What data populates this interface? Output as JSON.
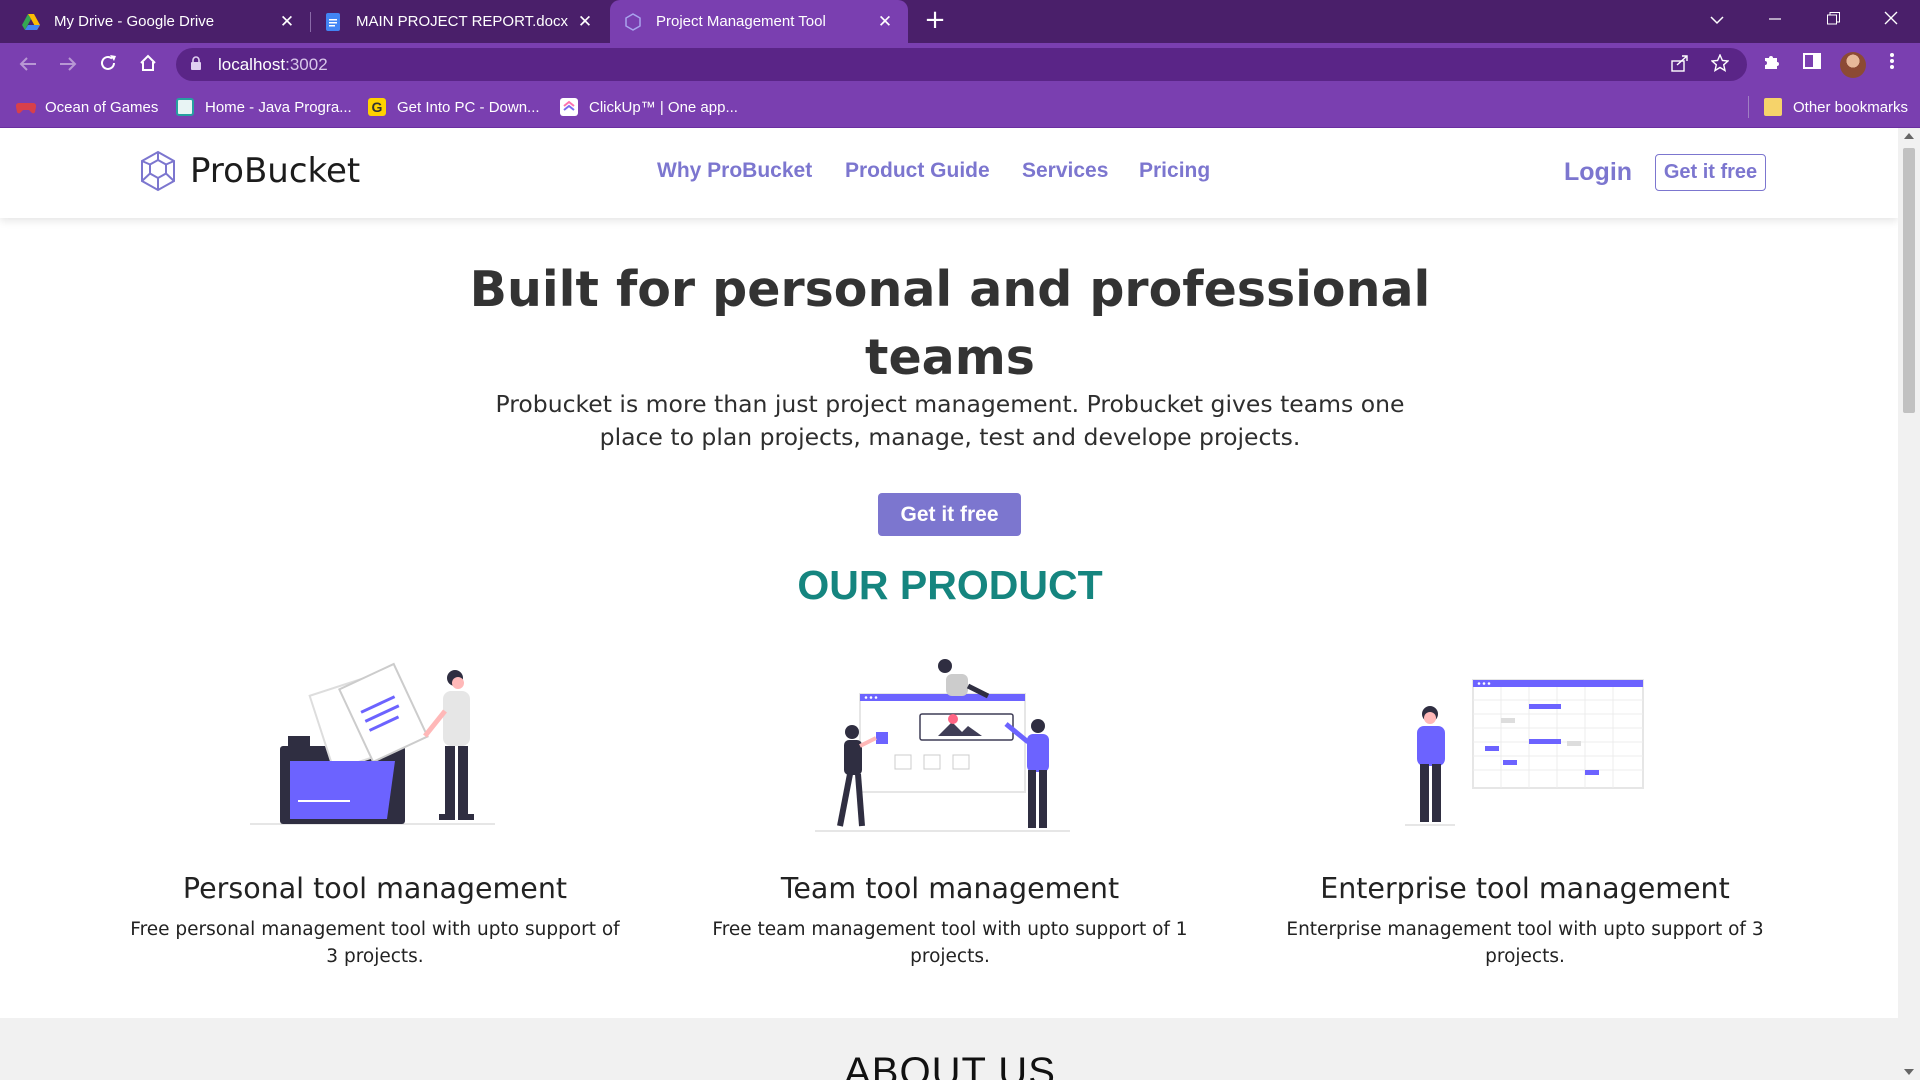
{
  "browser": {
    "tabs": [
      {
        "title": "My Drive - Google Drive",
        "close": "✕"
      },
      {
        "title": "MAIN PROJECT REPORT.docx - Go",
        "close": "✕"
      },
      {
        "title": "Project Management Tool",
        "close": "✕"
      }
    ],
    "new_tab": "+",
    "address": {
      "host": "localhost",
      "port": ":3002"
    },
    "bookmarks": [
      {
        "label": "Ocean of Games",
        "color": "#d8404a"
      },
      {
        "label": "Home - Java Progra...",
        "color": "#26a0a0"
      },
      {
        "label": "Get Into PC - Down...",
        "color": "#333333"
      },
      {
        "label": "ClickUp™ | One app...",
        "color": "#ffffff"
      }
    ],
    "other_bookmarks": "Other bookmarks",
    "colors": {
      "tabstrip": "#4a1f6a",
      "toolbar": "#7a3fb0"
    }
  },
  "site": {
    "brand": "ProBucket",
    "nav": [
      "Why ProBucket",
      "Product Guide",
      "Services",
      "Pricing"
    ],
    "login": "Login",
    "get_free_nav": "Get it free",
    "colors": {
      "accent": "#7c76cf",
      "teal": "#15857f",
      "illustration": "#6c63ff"
    }
  },
  "hero": {
    "title": "Built for personal and professional teams",
    "subtitle": "Probucket is more than just project management. Probucket gives teams one place to plan projects, manage, test and develope projects.",
    "cta": "Get it free"
  },
  "product": {
    "heading": "OUR PRODUCT",
    "cards": [
      {
        "title": "Personal tool management",
        "desc": "Free personal management tool with upto support of 3 projects.",
        "icon": "folder-documents-illustration"
      },
      {
        "title": "Team tool management",
        "desc": "Free team management tool with upto support of 1 projects.",
        "icon": "team-collaboration-illustration"
      },
      {
        "title": "Enterprise tool management",
        "desc": "Enterprise management tool with upto support of 3 projects.",
        "icon": "schedule-grid-illustration"
      }
    ]
  },
  "about": {
    "heading": "ABOUT US"
  }
}
